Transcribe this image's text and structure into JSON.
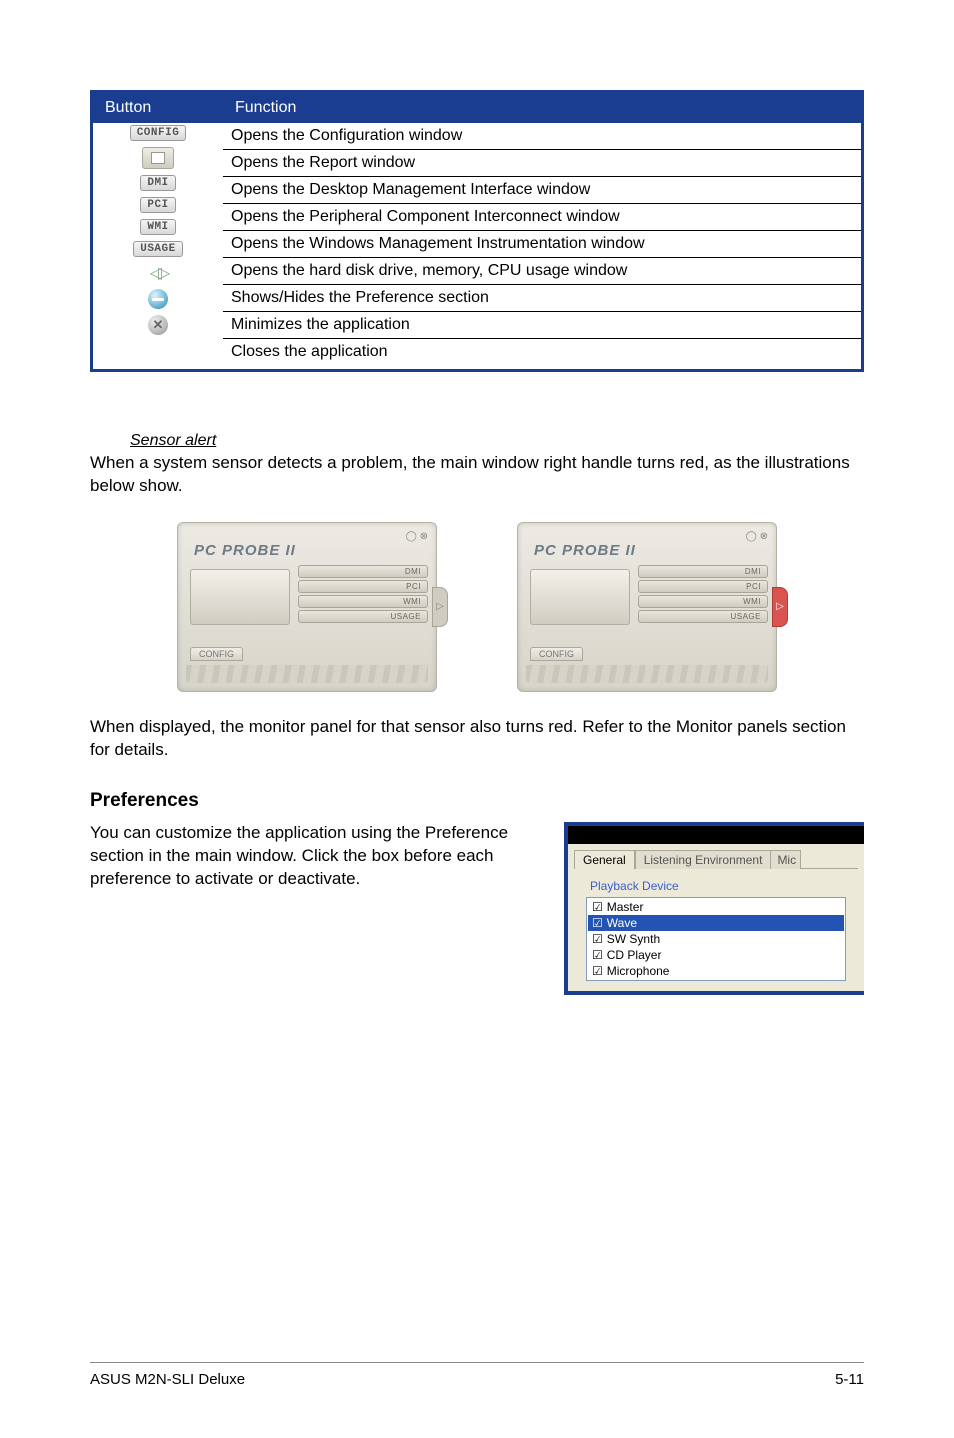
{
  "table": {
    "headers": {
      "button": "Button",
      "function": "Function"
    },
    "rows": [
      {
        "icon_label": "CONFIG",
        "icon_type": "tab",
        "fn": "Opens the Configuration window"
      },
      {
        "icon_label": "",
        "icon_type": "report",
        "fn": "Opens the Report window"
      },
      {
        "icon_label": "DMI",
        "icon_type": "tab",
        "fn": "Opens the Desktop Management Interface window"
      },
      {
        "icon_label": "PCI",
        "icon_type": "tab",
        "fn": "Opens the Peripheral Component Interconnect window"
      },
      {
        "icon_label": "WMI",
        "icon_type": "tab",
        "fn": "Opens the Windows Management Instrumentation window"
      },
      {
        "icon_label": "USAGE",
        "icon_type": "tab",
        "fn": "Opens the hard disk drive, memory, CPU usage window"
      },
      {
        "icon_label": "",
        "icon_type": "arrows",
        "fn": "Shows/Hides the Preference section"
      },
      {
        "icon_label": "",
        "icon_type": "minimize",
        "fn": "Minimizes the application"
      },
      {
        "icon_label": "",
        "icon_type": "close",
        "fn": "Closes the application"
      }
    ]
  },
  "sensor": {
    "heading": "Sensor alert",
    "para1": "When a system sensor detects a problem, the main window right handle turns red, as the illustrations below show.",
    "para2": "When displayed, the monitor panel for that sensor also turns red. Refer to the Monitor panels section for details.",
    "probe_title": "PC PROBE II",
    "probe_buttons": [
      "DMI",
      "PCI",
      "WMI",
      "USAGE"
    ],
    "probe_config": "CONFIG"
  },
  "prefs": {
    "heading": "Preferences",
    "text": "You can customize the application using the Preference section in the main window. Click the box before each preference to activate or deactivate.",
    "tabs": {
      "general": "General",
      "listening": "Listening Environment",
      "mic": "Mic"
    },
    "group": "Playback Device",
    "items": [
      {
        "label": "Master",
        "selected": false
      },
      {
        "label": "Wave",
        "selected": true
      },
      {
        "label": "SW Synth",
        "selected": false
      },
      {
        "label": "CD Player",
        "selected": false
      },
      {
        "label": "Microphone",
        "selected": false
      }
    ]
  },
  "footer": {
    "left": "ASUS M2N-SLI Deluxe",
    "right": "5-11"
  },
  "glyphs": {
    "arrow": "▷",
    "circle_top": "◯ ⊗"
  }
}
